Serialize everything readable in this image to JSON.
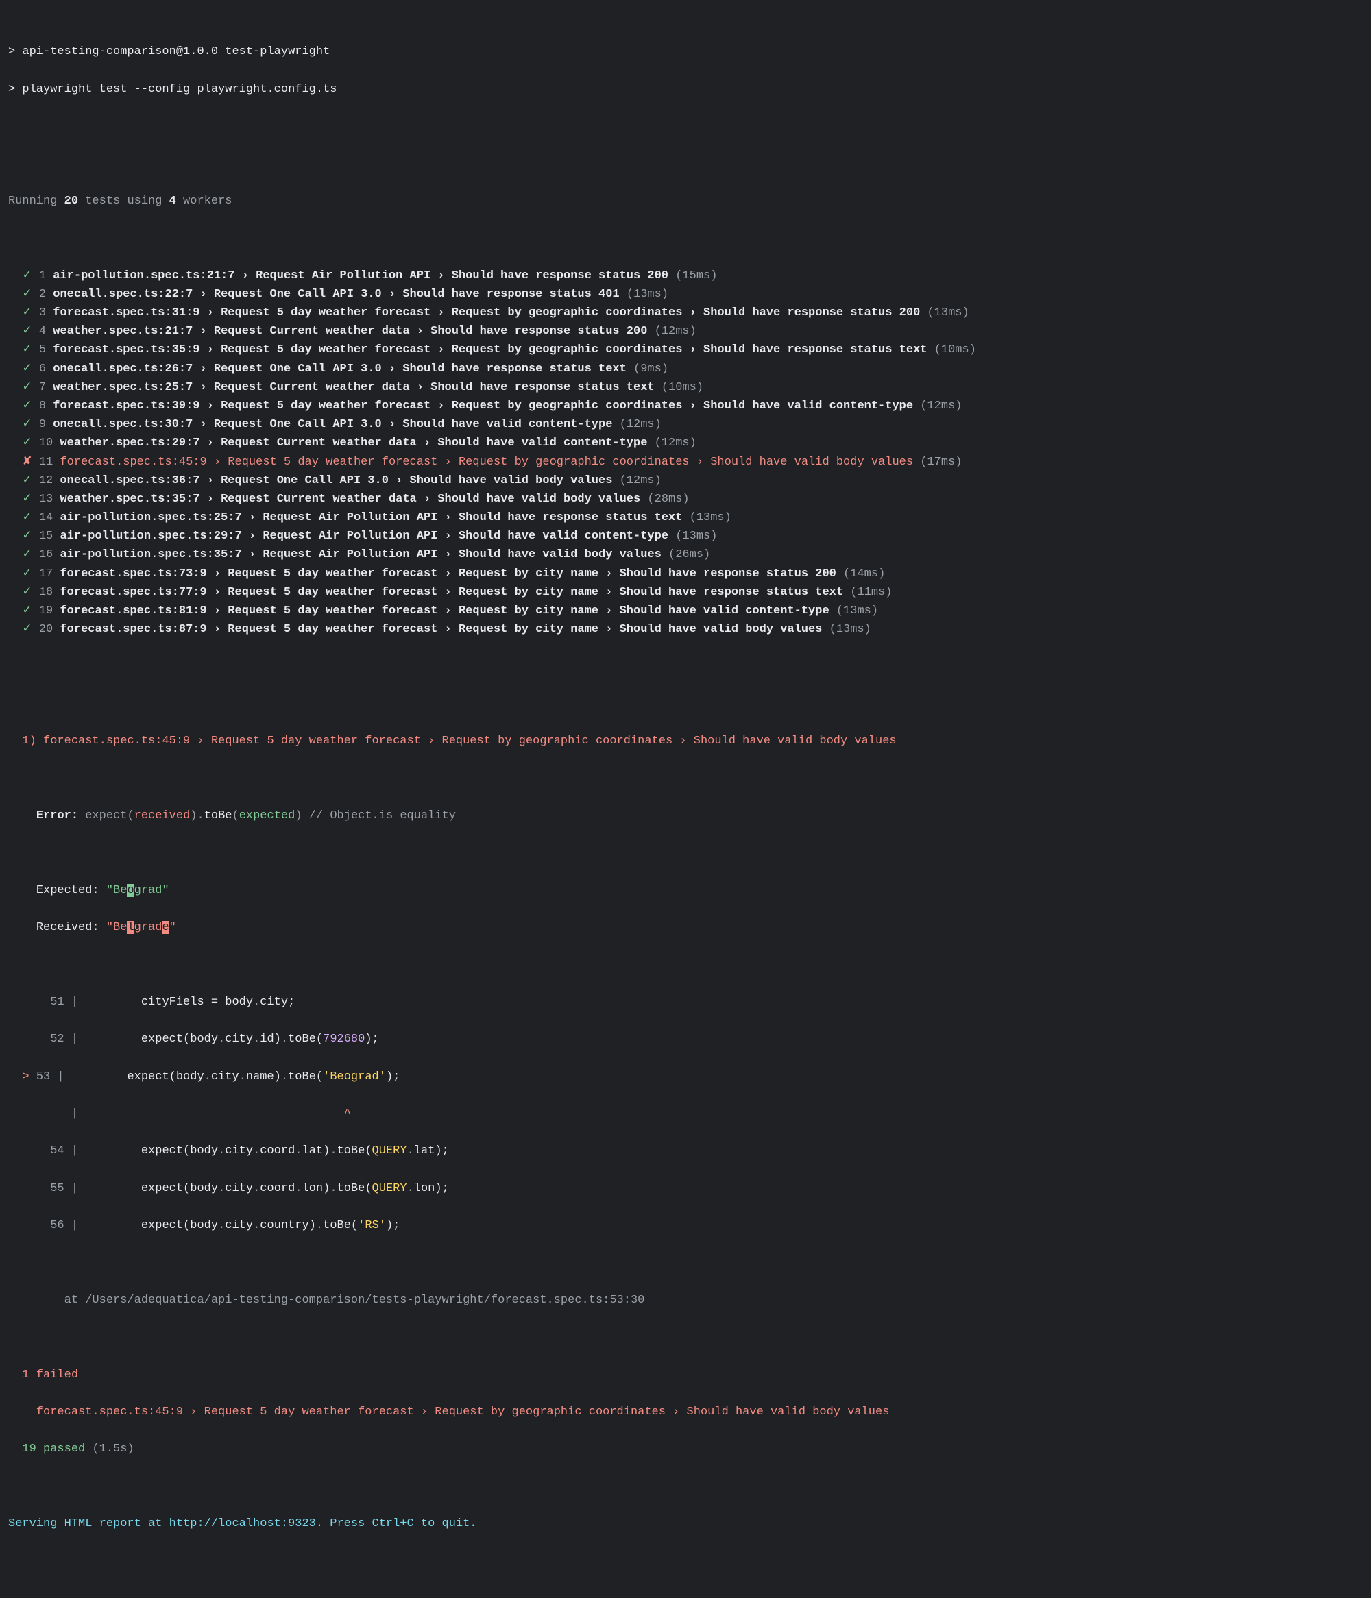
{
  "header": {
    "prompt1": "> api-testing-comparison@1.0.0 test-playwright",
    "prompt2": "> playwright test --config playwright.config.ts"
  },
  "running": {
    "prefix": "Running ",
    "tests_count": "20",
    "mid": " tests using ",
    "workers_count": "4",
    "suffix": " workers"
  },
  "tests": [
    {
      "n": "1",
      "status": "pass",
      "text": "air-pollution.spec.ts:21:7 › Request Air Pollution API › Should have response status 200",
      "time": "(15ms)"
    },
    {
      "n": "2",
      "status": "pass",
      "text": "onecall.spec.ts:22:7 › Request One Call API 3.0 › Should have response status 401",
      "time": "(13ms)"
    },
    {
      "n": "3",
      "status": "pass",
      "text": "forecast.spec.ts:31:9 › Request 5 day weather forecast › Request by geographic coordinates › Should have response status 200",
      "time": "(13ms)"
    },
    {
      "n": "4",
      "status": "pass",
      "text": "weather.spec.ts:21:7 › Request Current weather data › Should have response status 200",
      "time": "(12ms)"
    },
    {
      "n": "5",
      "status": "pass",
      "text": "forecast.spec.ts:35:9 › Request 5 day weather forecast › Request by geographic coordinates › Should have response status text",
      "time": "(10ms)"
    },
    {
      "n": "6",
      "status": "pass",
      "text": "onecall.spec.ts:26:7 › Request One Call API 3.0 › Should have response status text",
      "time": "(9ms)"
    },
    {
      "n": "7",
      "status": "pass",
      "text": "weather.spec.ts:25:7 › Request Current weather data › Should have response status text",
      "time": "(10ms)"
    },
    {
      "n": "8",
      "status": "pass",
      "text": "forecast.spec.ts:39:9 › Request 5 day weather forecast › Request by geographic coordinates › Should have valid content-type",
      "time": "(12ms)"
    },
    {
      "n": "9",
      "status": "pass",
      "text": "onecall.spec.ts:30:7 › Request One Call API 3.0 › Should have valid content-type",
      "time": "(12ms)"
    },
    {
      "n": "10",
      "status": "pass",
      "text": "weather.spec.ts:29:7 › Request Current weather data › Should have valid content-type",
      "time": "(12ms)"
    },
    {
      "n": "11",
      "status": "fail",
      "text": "forecast.spec.ts:45:9 › Request 5 day weather forecast › Request by geographic coordinates › Should have valid body values",
      "time": "(17ms)"
    },
    {
      "n": "12",
      "status": "pass",
      "text": "onecall.spec.ts:36:7 › Request One Call API 3.0 › Should have valid body values",
      "time": "(12ms)"
    },
    {
      "n": "13",
      "status": "pass",
      "text": "weather.spec.ts:35:7 › Request Current weather data › Should have valid body values",
      "time": "(28ms)"
    },
    {
      "n": "14",
      "status": "pass",
      "text": "air-pollution.spec.ts:25:7 › Request Air Pollution API › Should have response status text",
      "time": "(13ms)"
    },
    {
      "n": "15",
      "status": "pass",
      "text": "air-pollution.spec.ts:29:7 › Request Air Pollution API › Should have valid content-type",
      "time": "(13ms)"
    },
    {
      "n": "16",
      "status": "pass",
      "text": "air-pollution.spec.ts:35:7 › Request Air Pollution API › Should have valid body values",
      "time": "(26ms)"
    },
    {
      "n": "17",
      "status": "pass",
      "text": "forecast.spec.ts:73:9 › Request 5 day weather forecast › Request by city name › Should have response status 200",
      "time": "(14ms)"
    },
    {
      "n": "18",
      "status": "pass",
      "text": "forecast.spec.ts:77:9 › Request 5 day weather forecast › Request by city name › Should have response status text",
      "time": "(11ms)"
    },
    {
      "n": "19",
      "status": "pass",
      "text": "forecast.spec.ts:81:9 › Request 5 day weather forecast › Request by city name › Should have valid content-type",
      "time": "(13ms)"
    },
    {
      "n": "20",
      "status": "pass",
      "text": "forecast.spec.ts:87:9 › Request 5 day weather forecast › Request by city name › Should have valid body values",
      "time": "(13ms)"
    }
  ],
  "failure": {
    "title": "  1) forecast.spec.ts:45:9 › Request 5 day weather forecast › Request by geographic coordinates › Should have valid body values ",
    "error_label": "Error: ",
    "expect_word": "expect(",
    "received_word": "received",
    "tobe_mid": ").",
    "tobe_word": "toBe",
    "open_paren": "(",
    "expected_word": "expected",
    "close_paren": ")",
    "comment": " // Object.is equality",
    "expected_label": "Expected: ",
    "received_label": "Received: ",
    "expected_value_parts": {
      "pre": "\"Be",
      "hl": "o",
      "post": "grad\""
    },
    "received_value_parts": {
      "pre": "\"Be",
      "hl1": "l",
      "mid": "grad",
      "hl2": "e",
      "post": "\""
    },
    "code": {
      "l51": {
        "n": "  51 | ",
        "pre": "        cityFiels = body",
        "dot1": ".",
        "city": "city;"
      },
      "l52": {
        "n": "  52 | ",
        "pre": "        expect(body",
        "dots": ".city.id).",
        "tobe": "toBe(",
        "val": "792680",
        "post": ");"
      },
      "l53": {
        "marker": "> ",
        "n": "53 | ",
        "pre": "        expect(body",
        "dots": ".city.name).",
        "tobe": "toBe(",
        "val": "'Beograd'",
        "post": ");"
      },
      "caret": {
        "n": "     | ",
        "spaces": "                                     ",
        "caret": "^"
      },
      "l54": {
        "n": "  54 | ",
        "pre": "        expect(body",
        "dots": ".city.coord.lat).",
        "tobe": "toBe(",
        "q": "QUERY",
        "dotlat": ".lat);",
        "post": ""
      },
      "l55": {
        "n": "  55 | ",
        "pre": "        expect(body",
        "dots": ".city.coord.lon).",
        "tobe": "toBe(",
        "q": "QUERY",
        "dotlon": ".lon);",
        "post": ""
      },
      "l56": {
        "n": "  56 | ",
        "pre": "        expect(body",
        "dots": ".city.country).",
        "tobe": "toBe(",
        "val": "'RS'",
        "post": ");"
      }
    },
    "stack": "        at /Users/adequatica/api-testing-comparison/tests-playwright/forecast.spec.ts:53:30"
  },
  "summary": {
    "failed_count": "  1",
    "failed_word": " failed",
    "failed_detail": "    forecast.spec.ts:45:9 › Request 5 day weather forecast › Request by geographic coordinates › Should have valid body values ",
    "passed_count": "  19",
    "passed_word": " passed",
    "duration": " (1.5s)"
  },
  "serving": "Serving HTML report at http://localhost:9323. Press Ctrl+C to quit."
}
